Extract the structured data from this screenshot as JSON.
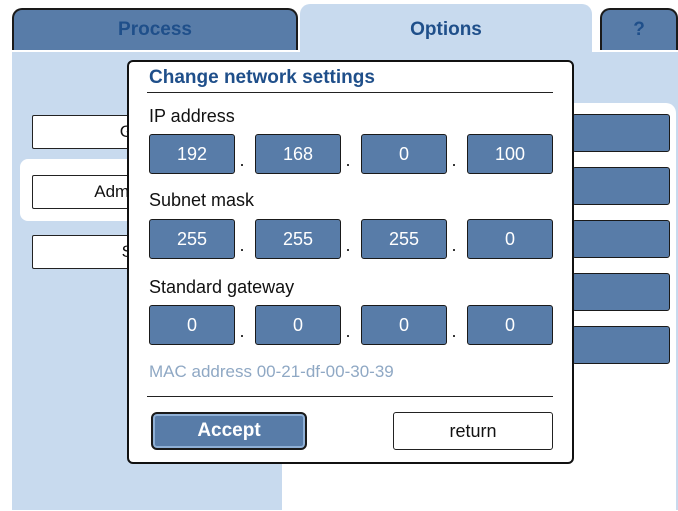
{
  "tabs": {
    "process": "Process",
    "options": "Options",
    "help": "?"
  },
  "menu": {
    "item1": "G",
    "item2": "Admi",
    "item3": "S"
  },
  "dialog": {
    "title": "Change network settings",
    "ip_label": "IP address",
    "ip": [
      "192",
      "168",
      "0",
      "100"
    ],
    "subnet_label": "Subnet mask",
    "subnet": [
      "255",
      "255",
      "255",
      "0"
    ],
    "gateway_label": "Standard gateway",
    "gateway": [
      "0",
      "0",
      "0",
      "0"
    ],
    "separator": ".",
    "mac": "MAC address 00-21-df-00-30-39",
    "accept": "Accept",
    "return": "return"
  },
  "colors": {
    "accent": "#587ca8",
    "title": "#1f4f8a",
    "panel": "#c8daee",
    "mac_text": "#8fa8c4"
  }
}
